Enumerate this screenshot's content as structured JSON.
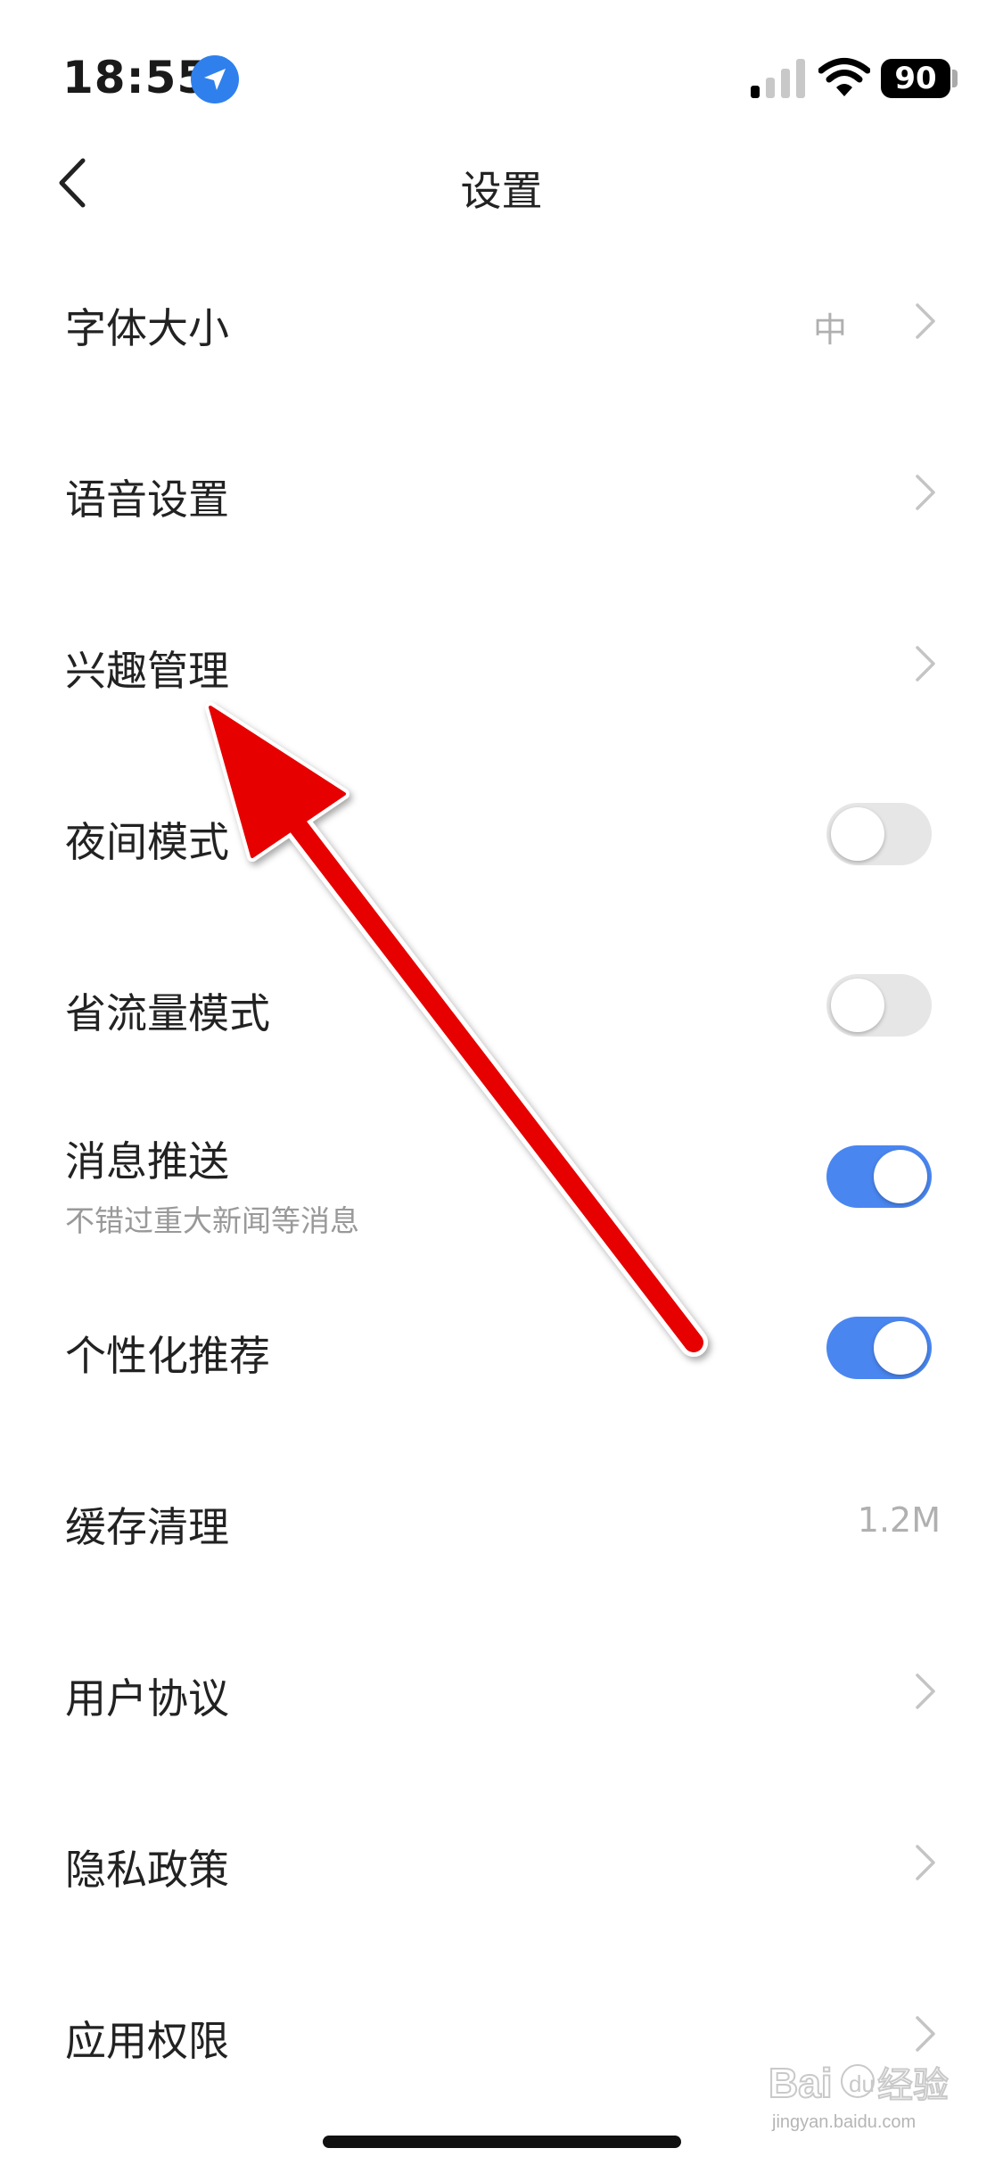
{
  "status_bar": {
    "time": "18:55",
    "battery": "90"
  },
  "nav": {
    "title": "设置"
  },
  "rows": [
    {
      "label": "字体大小",
      "value": "中"
    },
    {
      "label": "语音设置"
    },
    {
      "label": "兴趣管理"
    },
    {
      "label": "夜间模式",
      "toggle": false
    },
    {
      "label": "省流量模式",
      "toggle": false
    },
    {
      "label": "消息推送",
      "sublabel": "不错过重大新闻等消息",
      "toggle": true
    },
    {
      "label": "个性化推荐",
      "toggle": true
    },
    {
      "label": "缓存清理",
      "value": "1.2M"
    },
    {
      "label": "用户协议"
    },
    {
      "label": "隐私政策"
    },
    {
      "label": "应用权限"
    }
  ],
  "watermark": {
    "text": "Baidu经验",
    "url": "jingyan.baidu.com"
  },
  "colors": {
    "toggle_on": "#4a86f0",
    "toggle_off": "#e6e6e6",
    "arrow": "#e60000"
  }
}
